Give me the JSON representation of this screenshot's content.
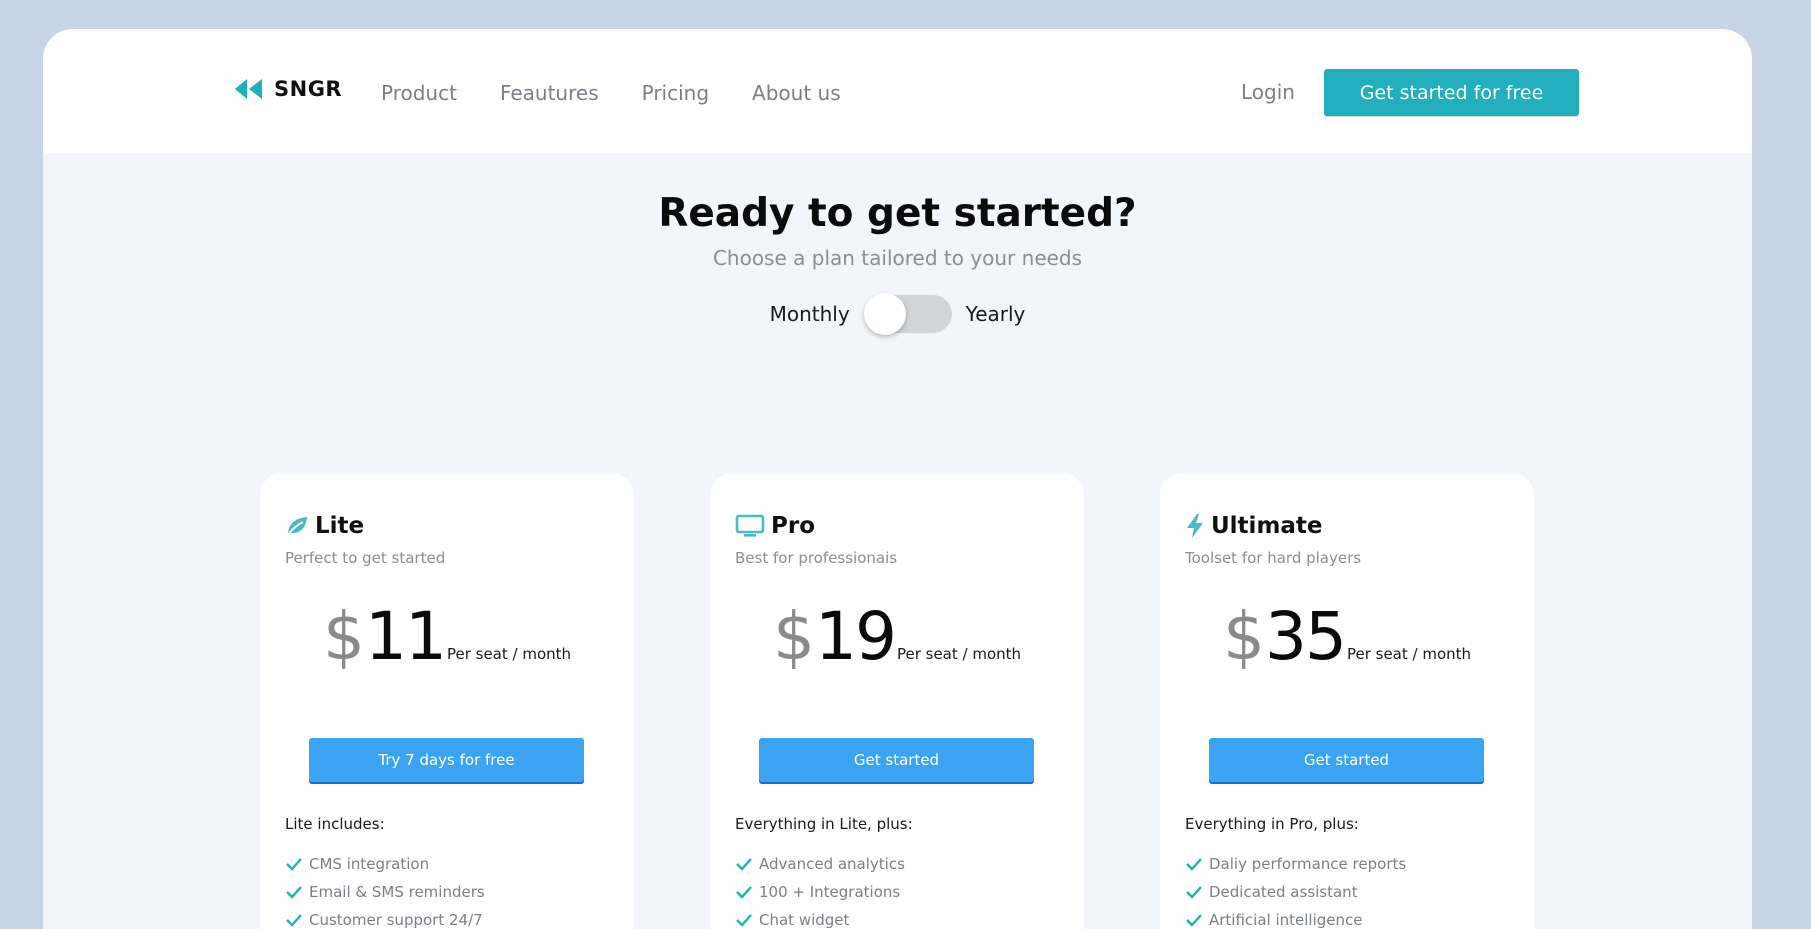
{
  "brand": {
    "name": "SNGR"
  },
  "nav": {
    "items": [
      {
        "label": "Product"
      },
      {
        "label": "Feautures"
      },
      {
        "label": "Pricing"
      },
      {
        "label": "About us"
      }
    ],
    "login": "Login",
    "cta": "Get started for free"
  },
  "hero": {
    "title": "Ready to get started?",
    "subtitle": "Choose a plan tailored to your needs"
  },
  "billing_toggle": {
    "left_label": "Monthly",
    "right_label": "Yearly",
    "state": "off"
  },
  "plans": [
    {
      "icon": "leaf-icon",
      "name": "Lite",
      "tagline": "Perfect to get started",
      "currency": "$",
      "price": "11",
      "unit": "Per seat / month",
      "button": "Try 7 days for free",
      "includes_title": "Lite includes:",
      "features": [
        "CMS integration",
        "Email & SMS reminders",
        "Customer support 24/7"
      ]
    },
    {
      "icon": "monitor-icon",
      "name": "Pro",
      "tagline": "Best for professionais",
      "currency": "$",
      "price": "19",
      "unit": "Per seat / month",
      "button": "Get started",
      "includes_title": "Everything in Lite, plus:",
      "features": [
        "Advanced analytics",
        "100 + Integrations",
        "Chat widget"
      ]
    },
    {
      "icon": "lightning-icon",
      "name": "Ultimate",
      "tagline": "Toolset for hard players",
      "currency": "$",
      "price": "35",
      "unit": "Per seat / month",
      "button": "Get started",
      "includes_title": "Everything in Pro, plus:",
      "features": [
        "Daliy performance reports",
        "Dedicated assistant",
        "Artificial intelligence"
      ]
    }
  ],
  "colors": {
    "background": "#c8d5e6",
    "accent_teal": "#22aebc",
    "button_blue": "#3aa3f2",
    "icon_teal": "#4ab9c9"
  }
}
